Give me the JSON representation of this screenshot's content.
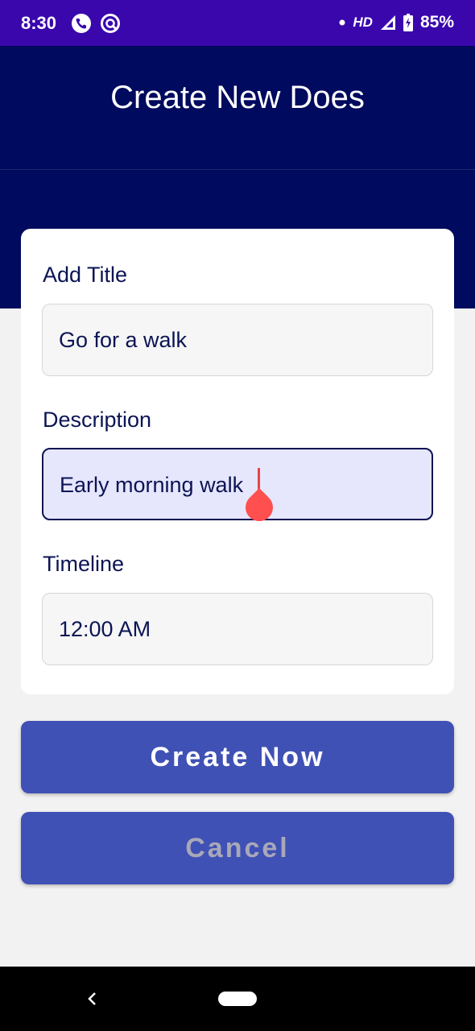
{
  "status_bar": {
    "time": "8:30",
    "network": "HD",
    "battery": "85%",
    "icons": [
      "phone-call-icon",
      "vpn-icon",
      "dot-icon",
      "signal-icon",
      "battery-charging-icon"
    ]
  },
  "header": {
    "title": "Create New Does"
  },
  "form": {
    "title_label": "Add Title",
    "title_value": "Go for a walk",
    "description_label": "Description",
    "description_value": "Early morning walk",
    "timeline_label": "Timeline",
    "timeline_value": "12:00 AM"
  },
  "buttons": {
    "create": "Create Now",
    "cancel": "Cancel"
  },
  "colors": {
    "status_bar": "#3a07ad",
    "header": "#000a5e",
    "button": "#4051b5",
    "cursor": "#ff4f4f"
  }
}
